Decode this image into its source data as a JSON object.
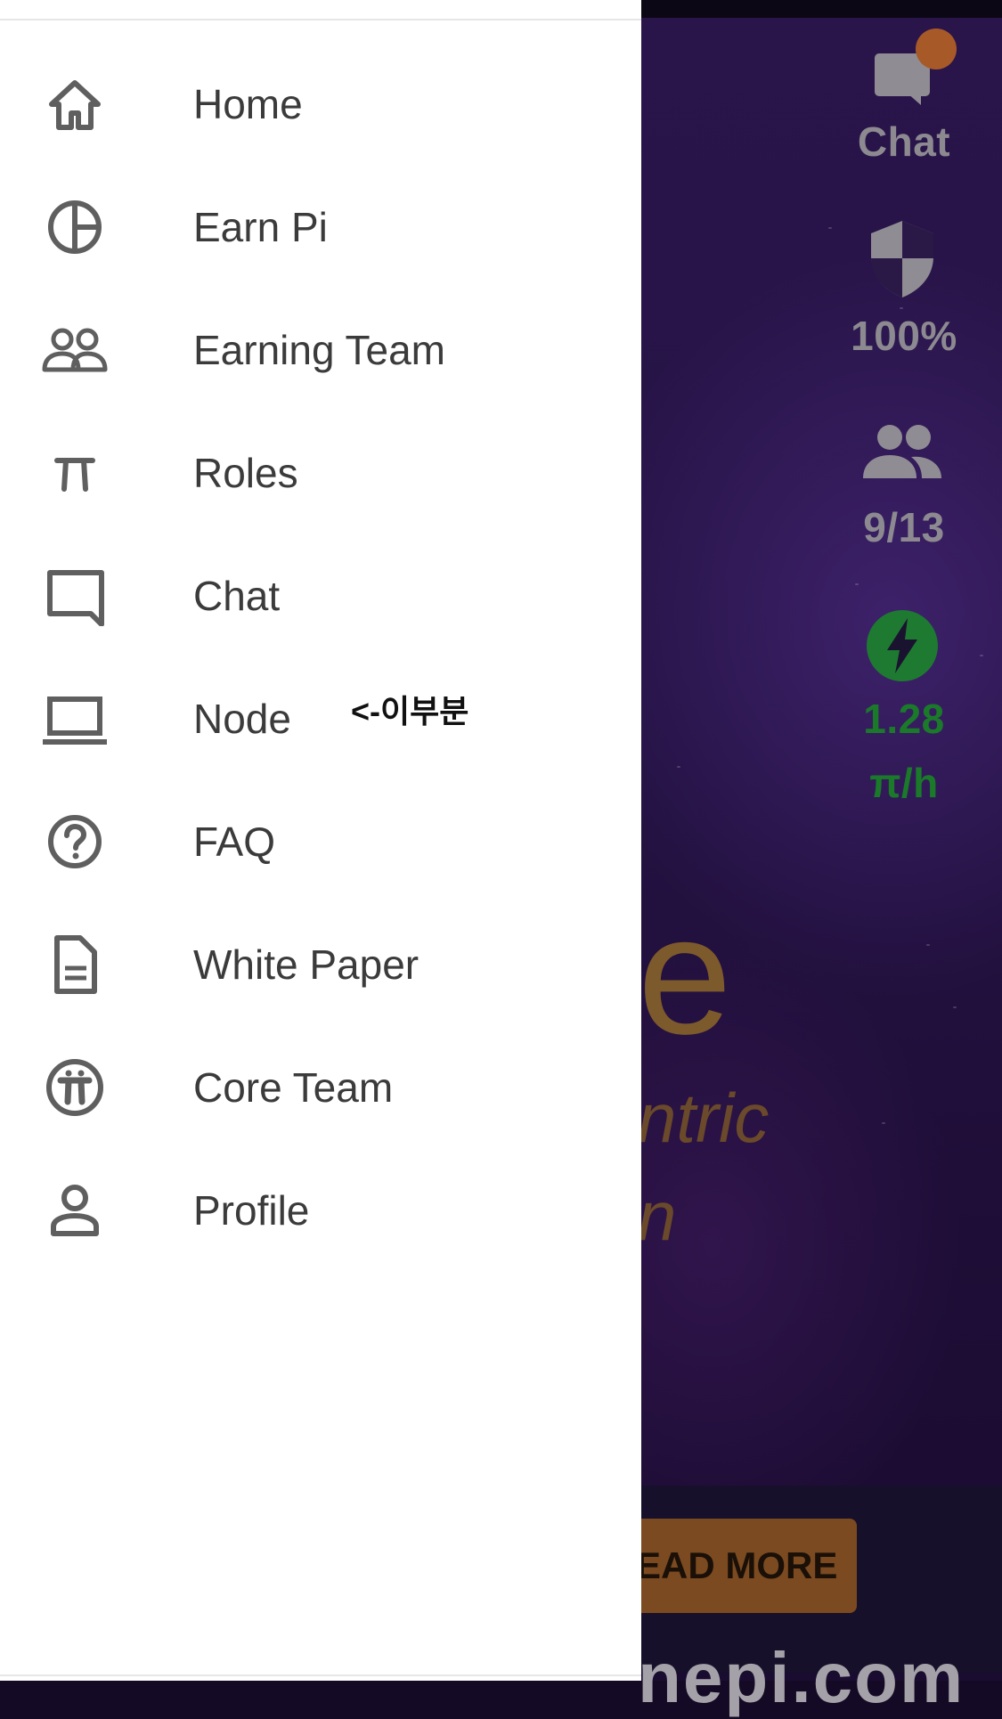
{
  "menu": {
    "items": [
      {
        "label": "Home",
        "icon": "home-icon"
      },
      {
        "label": "Earn Pi",
        "icon": "pie-chart-icon"
      },
      {
        "label": "Earning Team",
        "icon": "team-icon"
      },
      {
        "label": "Roles",
        "icon": "pi-icon"
      },
      {
        "label": "Chat",
        "icon": "chat-icon"
      },
      {
        "label": "Node",
        "icon": "laptop-icon"
      },
      {
        "label": "FAQ",
        "icon": "help-circle-icon"
      },
      {
        "label": "White Paper",
        "icon": "document-icon"
      },
      {
        "label": "Core Team",
        "icon": "pi-logo-icon"
      },
      {
        "label": "Profile",
        "icon": "profile-icon"
      }
    ],
    "annotation": "<-이부분"
  },
  "sidebar_stats": {
    "chat_label": "Chat",
    "security_value": "100%",
    "team_value": "9/13",
    "mining_rate_value": "1.28",
    "mining_rate_unit": "π/h"
  },
  "background": {
    "headline_fragment": "e",
    "subtitle_fragment_1": "ntric",
    "subtitle_fragment_2": "n",
    "read_more_label": "EAD MORE",
    "url_fragment": "nepi.com"
  },
  "colors": {
    "accent_orange": "#a75a28",
    "mining_green": "#1e7a31",
    "drawer_bg": "#ffffff"
  }
}
